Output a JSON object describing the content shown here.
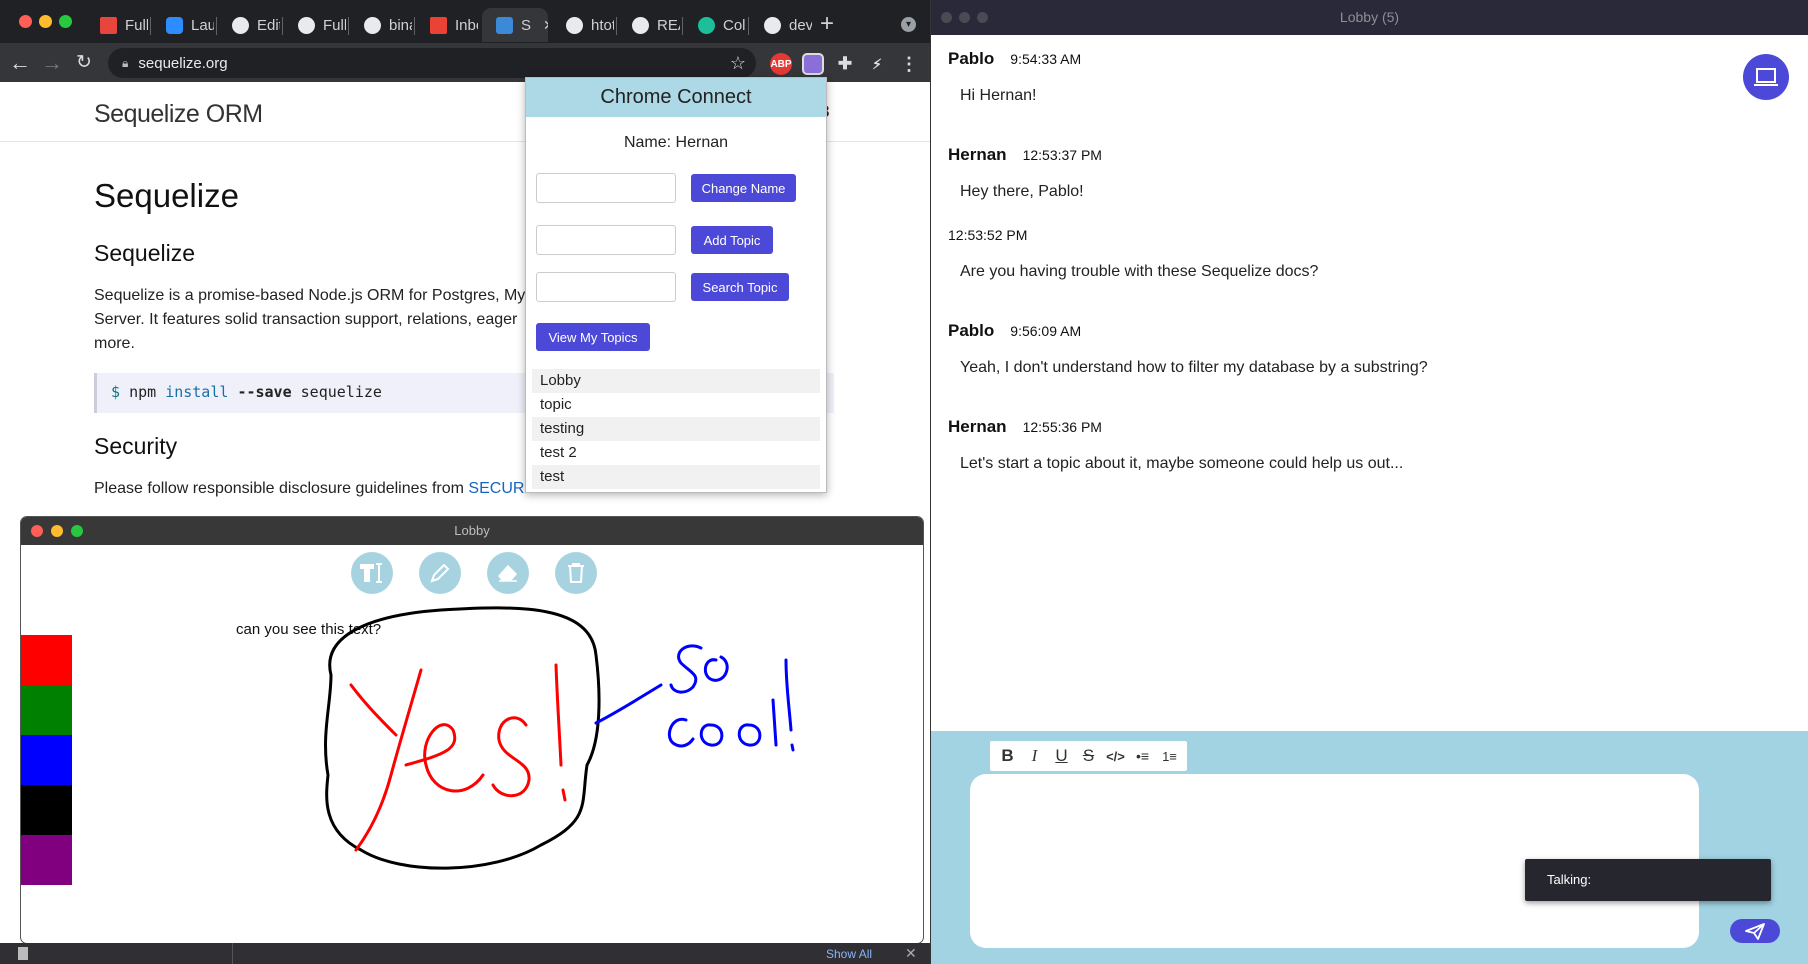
{
  "browser": {
    "tabs": [
      {
        "label": "Fulls",
        "favicon_color": "#e8453c"
      },
      {
        "label": "Laun",
        "favicon_color": "#2d8cff"
      },
      {
        "label": "Editi",
        "favicon_color": "#e8eaed"
      },
      {
        "label": "Fulls",
        "favicon_color": "#e8eaed"
      },
      {
        "label": "bina",
        "favicon_color": "#e8eaed"
      },
      {
        "label": "Inbo",
        "favicon_color": "#ea4335"
      },
      {
        "label": "S",
        "favicon_color": "#3b8ad8"
      },
      {
        "label": "htot",
        "favicon_color": "#e8eaed"
      },
      {
        "label": "REA",
        "favicon_color": "#e8eaed"
      },
      {
        "label": "Colo",
        "favicon_color": "#1dbf9a"
      },
      {
        "label": "deva",
        "favicon_color": "#e8eaed"
      }
    ],
    "new_tab": "+",
    "url": "sequelize.org",
    "ext_abp": "ABP"
  },
  "page": {
    "brand": "Sequelize ORM",
    "nav_fragment": "3",
    "title": "Sequelize",
    "section1": "Sequelize",
    "para1_visible": "Sequelize is a promise-based Node.js ORM for Postgres, My",
    "para1_line2": "Server. It features solid transaction support, relations, eager",
    "para1_line3": "more.",
    "code": {
      "dollar": "$",
      "npm": "npm",
      "install": "install",
      "flag": "--save",
      "pkg": "sequelize"
    },
    "section2": "Security",
    "para2": "Please follow responsible disclosure guidelines from ",
    "para2_link": "SECURITY.md"
  },
  "popup": {
    "title": "Chrome Connect",
    "name_label": "Name: Hernan",
    "change_name": "Change Name",
    "add_topic": "Add Topic",
    "search_topic": "Search Topic",
    "view_topics": "View My Topics",
    "topics": [
      "Lobby",
      "topic",
      "testing",
      "test 2",
      "test"
    ]
  },
  "draw_window": {
    "title": "Lobby",
    "canvas_text": "can you see this text?",
    "swatches": [
      "#ff0000",
      "#008000",
      "#0000ff",
      "#000000",
      "#800080"
    ]
  },
  "chat": {
    "title": "Lobby (5)",
    "messages": [
      {
        "author": "Pablo",
        "time": "9:54:33 AM",
        "text": "Hi Hernan!"
      },
      {
        "author": "Hernan",
        "time": "12:53:37 PM",
        "text": "Hey there, Pablo!"
      },
      {
        "author": "",
        "time": "12:53:52 PM",
        "text": "Are you having trouble with these Sequelize docs?"
      },
      {
        "author": "Pablo",
        "time": "9:56:09 AM",
        "text": "Yeah, I don't understand how to filter my database by a substring?"
      },
      {
        "author": "Hernan",
        "time": "12:55:36 PM",
        "text": "Let's start a topic about it, maybe someone could help us out..."
      }
    ],
    "format_buttons": [
      "B",
      "I",
      "U",
      "S",
      "</>",
      "•≡",
      "1≡"
    ],
    "talking_label": "Talking:"
  },
  "downloads": {
    "show_all": "Show All"
  }
}
